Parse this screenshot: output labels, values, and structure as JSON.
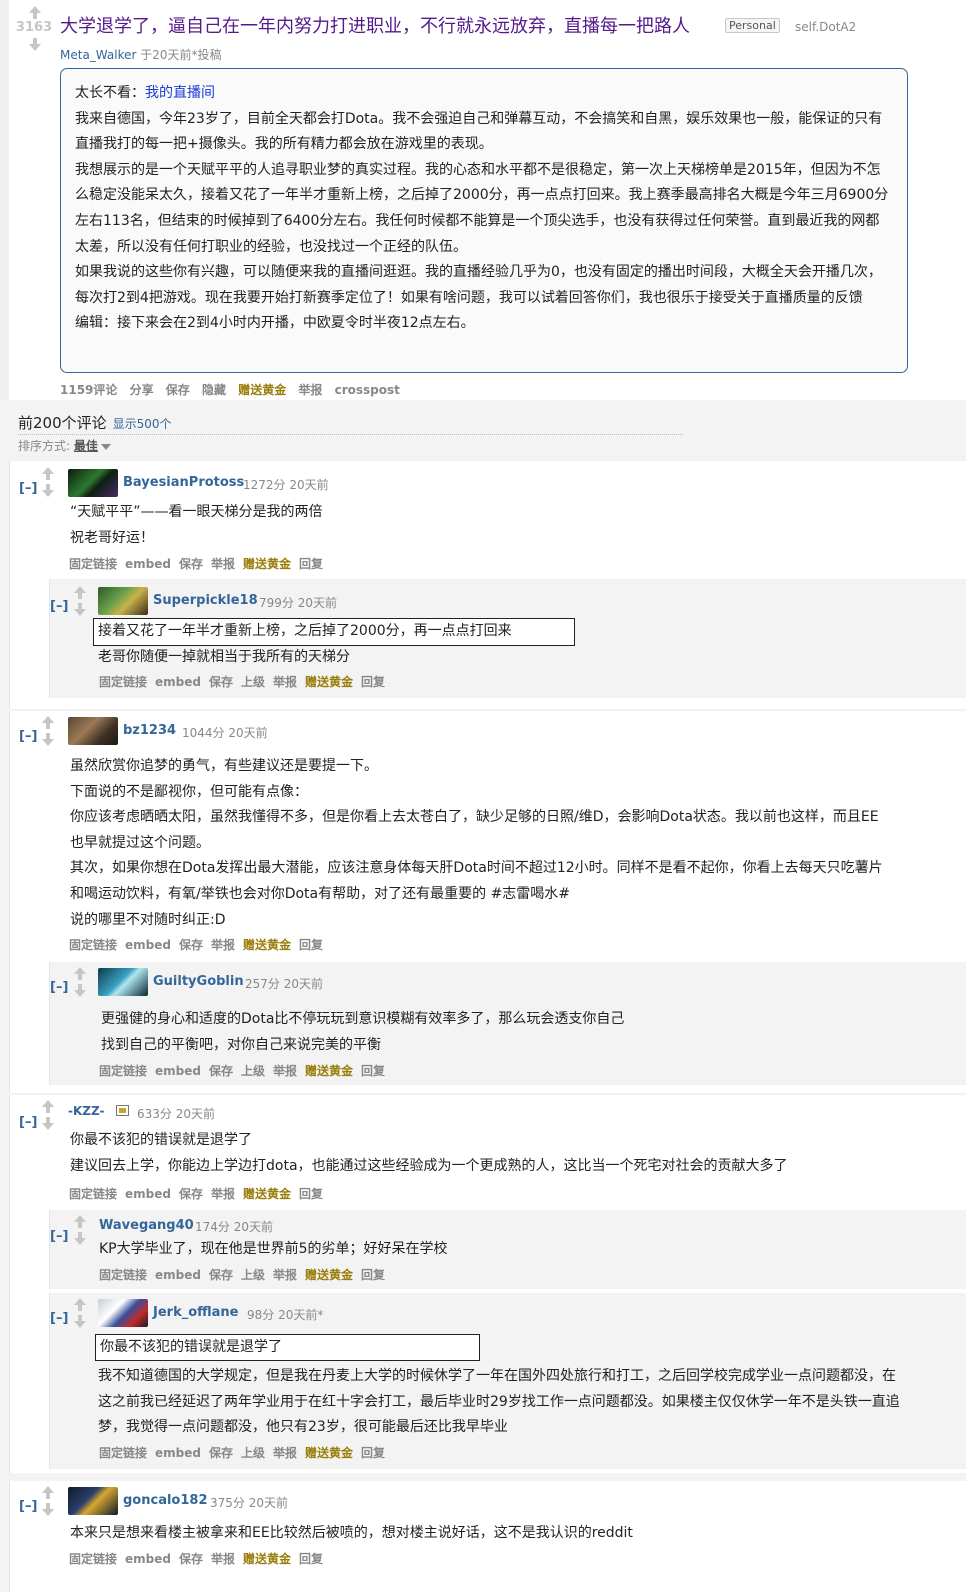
{
  "post": {
    "score": "3163",
    "title": "大学退学了，逼自己在一年内努力打进职业，不行就永远放弃，直播每一把路人",
    "flair": "Personal",
    "domain": "self.DotA2",
    "author": "Meta_Walker",
    "time": "于20天前*投稿",
    "tldr_label": "太长不看：",
    "tldr_link": "我的直播间",
    "paragraphs": [
      "我来自德国，今年23岁了，目前全天都会打Dota。我不会强迫自己和弹幕互动，不会搞笑和自黑，娱乐效果也一般，能保证的只有直播我打的每一把+摄像头。我的所有精力都会放在游戏里的表现。",
      "我想展示的是一个天赋平平的人追寻职业梦的真实过程。我的心态和水平都不是很稳定，第一次上天梯榜单是2015年，但因为不怎么稳定没能呆太久，接着又花了一年半才重新上榜，之后掉了2000分，再一点点打回来。我上赛季最高排名大概是今年三月6900分左右113名，但结束的时候掉到了6400分左右。我任何时候都不能算是一个顶尖选手，也没有获得过任何荣誉。直到最近我的网都太差，所以没有任何打职业的经验，也没找过一个正经的队伍。",
      "如果我说的这些你有兴趣，可以随便来我的直播间逛逛。我的直播经验几乎为0，也没有固定的播出时间段，大概全天会开播几次，每次打2到4把游戏。现在我要开始打新赛季定位了！如果有啥问题，我可以试着回答你们，我也很乐于接受关于直播质量的反馈",
      "编辑：接下来会在2到4小时内开播，中欧夏令时半夜12点左右。"
    ],
    "buttons": [
      "1159评论",
      "分享",
      "保存",
      "隐藏",
      "赠送黄金",
      "举报",
      "crosspost"
    ]
  },
  "comments_header": {
    "title": "前200个评论",
    "show_more": "显示500个",
    "sort_label": "排序方式:",
    "sort_value": "最佳"
  },
  "toggle": "[–]",
  "top_buttons": [
    "固定链接",
    "embed",
    "保存",
    "举报",
    "赠送黄金",
    "回复"
  ],
  "child_buttons": [
    "固定链接",
    "embed",
    "保存",
    "上级",
    "举报",
    "赠送黄金",
    "回复"
  ],
  "comments": {
    "c1": {
      "author": "BayesianProtoss",
      "meta": "1272分 20天前",
      "lines": [
        "“天赋平平”——看一眼天梯分是我的两倍",
        "祝老哥好运！"
      ]
    },
    "c2": {
      "author": "Superpickle18",
      "meta": "799分 20天前",
      "quote": "接着又花了一年半才重新上榜，之后掉了2000分，再一点点打回来",
      "lines": [
        "老哥你随便一掉就相当于我所有的天梯分"
      ]
    },
    "c3": {
      "author": "bz1234",
      "meta": "1044分 20天前",
      "lines": [
        "虽然欣赏你追梦的勇气，有些建议还是要提一下。",
        "下面说的不是鄙视你，但可能有点像：",
        "你应该考虑晒晒太阳，虽然我懂得不多，但是你看上去太苍白了，缺少足够的日照/维D，会影响Dota状态。我以前也这样，而且EE也早就提过这个问题。",
        "其次，如果你想在Dota发挥出最大潜能，应该注意身体每天肝Dota时间不超过12小时。同样不是看不起你，你看上去每天只吃薯片和喝运动饮料，有氧/举铁也会对你Dota有帮助，对了还有最重要的 #志雷喝水#",
        "说的哪里不对随时纠正:D"
      ]
    },
    "c4": {
      "author": "GuiltyGoblin",
      "meta": "257分 20天前",
      "lines": [
        "更强健的身心和适度的Dota比不停玩玩到意识模糊有效率多了，那么玩会透支你自己",
        "找到自己的平衡吧，对你自己来说完美的平衡"
      ]
    },
    "c5": {
      "author": "-KZZ-",
      "meta": "633分 20天前",
      "lines": [
        "你最不该犯的错误就是退学了",
        "建议回去上学，你能边上学边打dota，也能通过这些经验成为一个更成熟的人，这比当一个死宅对社会的贡献大多了"
      ]
    },
    "c6": {
      "author": "Wavegang40",
      "meta": "174分 20天前",
      "lines": [
        "KP大学毕业了，现在他是世界前5的劣单；好好呆在学校"
      ]
    },
    "c7": {
      "author": "Jerk_offlane",
      "meta": "98分 20天前*",
      "quote": "你最不该犯的错误就是退学了",
      "lines": [
        "我不知道德国的大学规定，但是我在丹麦上大学的时候休学了一年在国外四处旅行和打工，之后回学校完成学业一点问题都没，在这之前我已经延迟了两年学业用于在红十字会打工，最后毕业时29岁找工作一点问题都没。如果楼主仅仅休学一年不是头铁一直追梦，我觉得一点问题都没，他只有23岁，很可能最后还比我早毕业"
      ]
    },
    "c8": {
      "author": "goncalo182",
      "meta": "375分 20天前",
      "lines": [
        "本来只是想来看楼主被拿来和EE比较然后被喷的，想对楼主说好话，这不是我认识的reddit"
      ]
    }
  },
  "colors": {
    "link": "#369",
    "title": "#551a8b",
    "gold": "#9a7d0a",
    "meta": "#888",
    "border": "#369"
  }
}
